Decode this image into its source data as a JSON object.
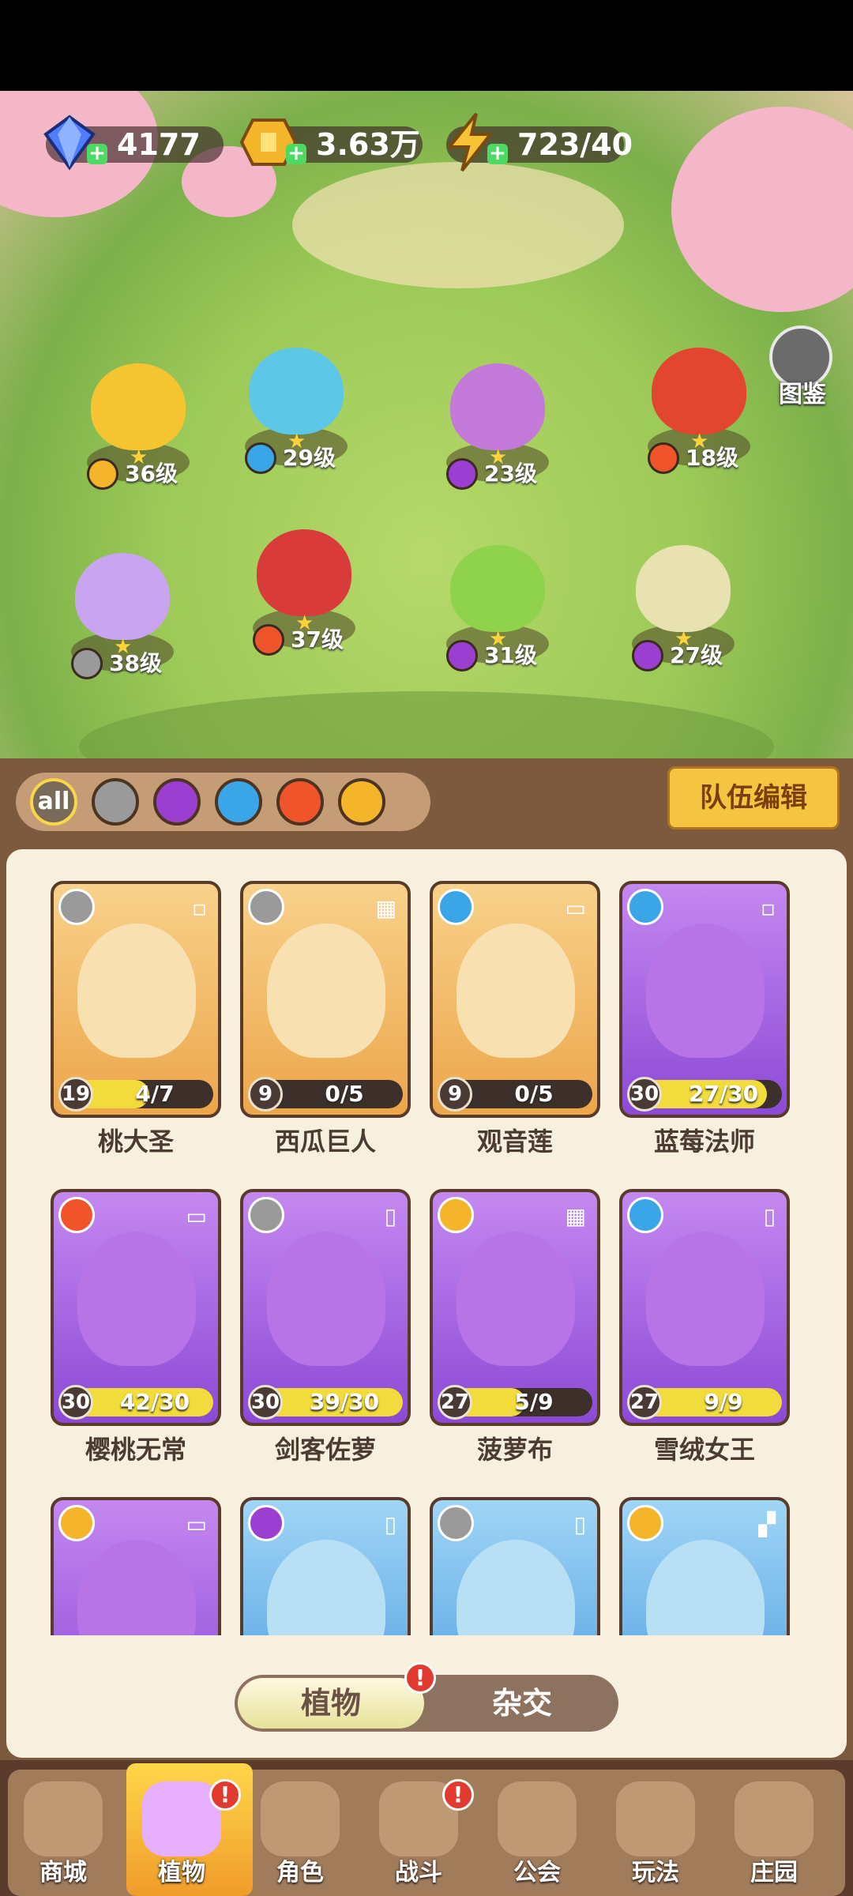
{
  "currencies": {
    "gems": "4177",
    "gold": "3.63万",
    "energy": "723/40"
  },
  "atlas_label": "图鉴",
  "field_plants": [
    {
      "level": "36级",
      "element": "lightning"
    },
    {
      "level": "29级",
      "element": "water"
    },
    {
      "level": "23级",
      "element": "potion"
    },
    {
      "level": "18级",
      "element": "fire"
    },
    {
      "level": "38级",
      "element": "sword"
    },
    {
      "level": "37级",
      "element": "fire"
    },
    {
      "level": "31级",
      "element": "potion"
    },
    {
      "level": "27级",
      "element": "potion"
    }
  ],
  "filters": [
    "all",
    "sword",
    "potion",
    "water",
    "fire",
    "lightning"
  ],
  "filter_all_label": "all",
  "team_edit_label": "队伍编辑",
  "cards": [
    {
      "name": "桃大圣",
      "level": "19",
      "progress": "4/7",
      "fill": 0.57,
      "rarity": "gold",
      "element": "sword"
    },
    {
      "name": "西瓜巨人",
      "level": "9",
      "progress": "0/5",
      "fill": 0.0,
      "rarity": "gold",
      "element": "sword"
    },
    {
      "name": "观音莲",
      "level": "9",
      "progress": "0/5",
      "fill": 0.0,
      "rarity": "gold",
      "element": "water"
    },
    {
      "name": "蓝莓法师",
      "level": "30",
      "progress": "27/30",
      "fill": 0.9,
      "rarity": "purple",
      "element": "water"
    },
    {
      "name": "樱桃无常",
      "level": "30",
      "progress": "42/30",
      "fill": 1.0,
      "rarity": "purple",
      "element": "fire"
    },
    {
      "name": "剑客佐萝",
      "level": "30",
      "progress": "39/30",
      "fill": 1.0,
      "rarity": "purple",
      "element": "sword"
    },
    {
      "name": "菠萝布",
      "level": "27",
      "progress": "5/9",
      "fill": 0.55,
      "rarity": "purple",
      "element": "lightning"
    },
    {
      "name": "雪绒女王",
      "level": "27",
      "progress": "9/9",
      "fill": 1.0,
      "rarity": "purple",
      "element": "water"
    },
    {
      "name": "",
      "level": "",
      "progress": "",
      "fill": 0,
      "rarity": "purple",
      "element": "lightning"
    },
    {
      "name": "",
      "level": "",
      "progress": "",
      "fill": 0,
      "rarity": "blue",
      "element": "potion"
    },
    {
      "name": "",
      "level": "",
      "progress": "",
      "fill": 0,
      "rarity": "blue",
      "element": "sword"
    },
    {
      "name": "",
      "level": "",
      "progress": "",
      "fill": 0,
      "rarity": "blue",
      "element": "lightning"
    }
  ],
  "toggle": {
    "plants": "植物",
    "hybrid": "杂交",
    "badge": "!"
  },
  "nav": [
    {
      "label": "商城",
      "icon": "shop-icon"
    },
    {
      "label": "植物",
      "icon": "plants-icon",
      "active": true,
      "badge": "!"
    },
    {
      "label": "角色",
      "icon": "character-icon"
    },
    {
      "label": "战斗",
      "icon": "battle-icon",
      "badge": "!"
    },
    {
      "label": "公会",
      "icon": "guild-icon"
    },
    {
      "label": "玩法",
      "icon": "gameplay-icon"
    },
    {
      "label": "庄园",
      "icon": "manor-lock-icon"
    }
  ],
  "colors": {
    "sword": "#9a9a9a",
    "water": "#3aa6e8",
    "potion": "#9b3fd0",
    "fire": "#f0542a",
    "lightning": "#f5b52a"
  }
}
